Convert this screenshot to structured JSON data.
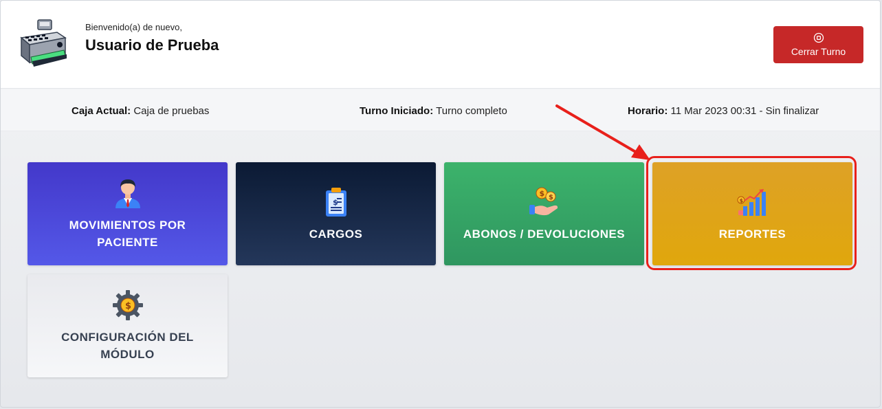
{
  "header": {
    "welcome": "Bienvenido(a) de nuevo,",
    "username": "Usuario de Prueba",
    "close_button": "Cerrar Turno"
  },
  "info": {
    "caja_label": "Caja Actual:",
    "caja_value": "Caja de pruebas",
    "turno_label": "Turno Iniciado:",
    "turno_value": "Turno completo",
    "horario_label": "Horario:",
    "horario_value": "11 Mar 2023 00:31 - Sin finalizar"
  },
  "tiles": {
    "movimientos_line1": "MOVIMIENTOS POR",
    "movimientos_line2": "PACIENTE",
    "cargos": "CARGOS",
    "abonos": "ABONOS / DEVOLUCIONES",
    "reportes": "REPORTES",
    "config_line1": "CONFIGURACIÓN DEL",
    "config_line2": "MÓDULO"
  },
  "colors": {
    "close_button": "#c62828",
    "tile_movimientos": "#4f46e5",
    "tile_cargos": "#1e2f4f",
    "tile_abonos": "#38a169",
    "tile_reportes": "#dfa316",
    "annotation": "#e8201b"
  },
  "icons": {
    "logo": "cash-register-icon",
    "close": "stop-circle-icon",
    "movimientos": "person-icon",
    "cargos": "clipboard-invoice-icon",
    "abonos": "hand-coins-icon",
    "reportes": "growth-chart-icon",
    "config": "gear-coin-icon"
  }
}
